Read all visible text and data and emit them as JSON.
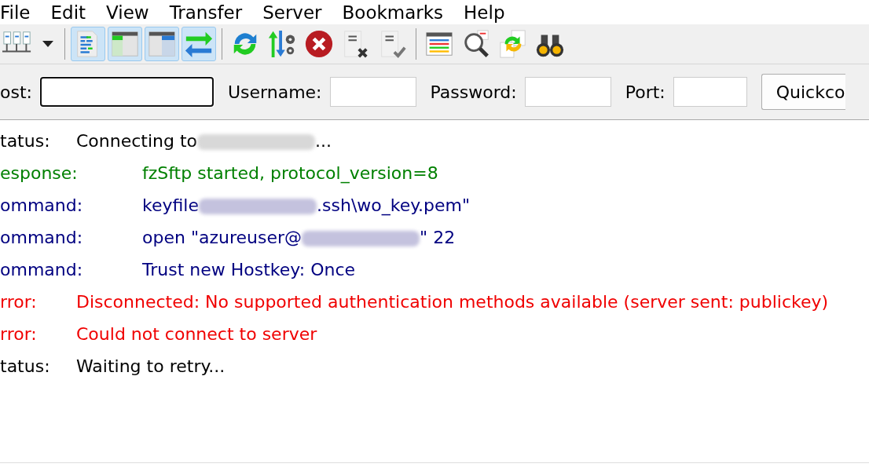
{
  "menu": [
    "File",
    "Edit",
    "View",
    "Transfer",
    "Server",
    "Bookmarks",
    "Help"
  ],
  "toolbar": [
    {
      "buttons": [
        {
          "kind": "sitemanager"
        },
        {
          "kind": "caret"
        }
      ]
    },
    {
      "buttons": [
        {
          "kind": "log",
          "selected": true
        },
        {
          "kind": "localtree",
          "selected": true
        },
        {
          "kind": "remotetree",
          "selected": true
        },
        {
          "kind": "queue",
          "selected": true
        }
      ]
    },
    {
      "buttons": [
        {
          "kind": "refresh"
        },
        {
          "kind": "process"
        },
        {
          "kind": "cancel"
        },
        {
          "kind": "disconnect"
        },
        {
          "kind": "reconnect"
        }
      ]
    },
    {
      "buttons": [
        {
          "kind": "filter"
        },
        {
          "kind": "compare"
        },
        {
          "kind": "sync"
        },
        {
          "kind": "search"
        }
      ]
    }
  ],
  "quickconnect": {
    "fields": [
      {
        "label": "ost:",
        "focused": true
      },
      {
        "label": "Username:",
        "focused": false
      },
      {
        "label": "Password:",
        "focused": false
      },
      {
        "label": "Port:",
        "focused": false
      }
    ],
    "button": "Quickco"
  },
  "log": [
    {
      "kind": "status",
      "type": "tatus:",
      "parts": [
        {
          "kind": "text",
          "text": "Connecting to"
        },
        {
          "kind": "redacted"
        },
        {
          "kind": "text",
          "text": "..."
        }
      ]
    },
    {
      "kind": "response",
      "type": "esponse:",
      "parts": [
        {
          "kind": "text",
          "text": "fzSftp started, protocol_version=8"
        }
      ]
    },
    {
      "kind": "command",
      "type": "ommand:",
      "parts": [
        {
          "kind": "text",
          "text": "keyfile"
        },
        {
          "kind": "redacted"
        },
        {
          "kind": "text",
          "text": ".ssh\\wo_key.pem\""
        }
      ]
    },
    {
      "kind": "command",
      "type": "ommand:",
      "parts": [
        {
          "kind": "text",
          "text": "open \"azureuser@"
        },
        {
          "kind": "redacted"
        },
        {
          "kind": "text",
          "text": "\" 22"
        }
      ]
    },
    {
      "kind": "command",
      "type": "ommand:",
      "parts": [
        {
          "kind": "text",
          "text": "Trust new Hostkey: Once"
        }
      ]
    },
    {
      "kind": "error",
      "type": "rror:",
      "parts": [
        {
          "kind": "text",
          "text": "Disconnected: No supported authentication methods available (server sent: publickey)"
        }
      ]
    },
    {
      "kind": "error",
      "type": "rror:",
      "parts": [
        {
          "kind": "text",
          "text": "Could not connect to server"
        }
      ]
    },
    {
      "kind": "status",
      "type": "tatus:",
      "parts": [
        {
          "kind": "text",
          "text": "Waiting to retry..."
        }
      ]
    }
  ]
}
